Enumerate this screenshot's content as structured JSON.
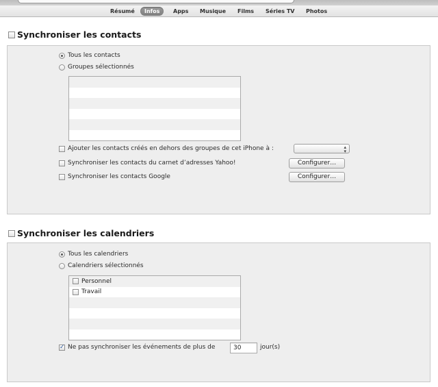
{
  "tabs": [
    "Résumé",
    "Infos",
    "Apps",
    "Musique",
    "Films",
    "Séries TV",
    "Photos"
  ],
  "active_tab": "Infos",
  "contacts": {
    "title": "Synchroniser les contacts",
    "radio_all": "Tous les contacts",
    "radio_selected": "Groupes sélectionnés",
    "add_contacts": "Ajouter les contacts créés en dehors des groupes de cet iPhone à :",
    "yahoo": "Synchroniser les contacts du carnet d’adresses Yahoo!",
    "google": "Synchroniser les contacts Google",
    "configure_label": "Configurer…"
  },
  "calendars": {
    "title": "Synchroniser les calendriers",
    "radio_all": "Tous les calendriers",
    "radio_selected": "Calendriers sélectionnés",
    "items": [
      "Personnel",
      "Travail"
    ],
    "no_sync_label": "Ne pas synchroniser les événements de plus de",
    "days_value": "30",
    "days_unit": "jour(s)"
  }
}
